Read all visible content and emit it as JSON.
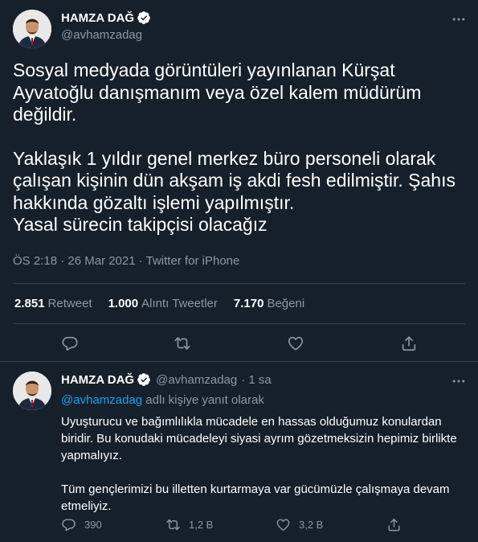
{
  "tweet": {
    "author_name": "HAMZA DAĞ",
    "author_handle": "@avhamzadag",
    "paragraphs": [
      "Sosyal medyada görüntüleri yayınlanan Kürşat Ayvatoğlu danışmanım veya özel kalem müdürüm değildir.",
      "Yaklaşık 1 yıldır genel merkez büro personeli olarak çalışan kişinin dün akşam iş akdi fesh edilmiştir. Şahıs hakkında gözaltı işlemi yapılmıştır.\nYasal sürecin takipçisi olacağız"
    ],
    "meta": "ÖS 2:18 · 26 Mar 2021 · Twitter for iPhone",
    "stats": {
      "retweets": "2.851",
      "retweets_label": "Retweet",
      "quotes": "1.000",
      "quotes_label": "Alıntı Tweetler",
      "likes": "7.170",
      "likes_label": "Beğeni"
    },
    "icons": [
      "reply-icon",
      "retweet-icon",
      "like-icon",
      "share-icon",
      "more-icon",
      "verified-icon"
    ]
  },
  "reply": {
    "author_name": "HAMZA DAĞ",
    "author_handle": "@avhamzadag",
    "time": "· 1 sa",
    "reply_to_mention": "@avhamzadag",
    "reply_to_suffix": "adlı kişiye yanıt olarak",
    "paragraphs": [
      "Uyuşturucu ve bağımlılıkla mücadele en hassas olduğumuz konulardan biridir. Bu konudaki mücadeleyi siyasi ayrım gözetmeksizin hepimiz birlikte yapmalıyız.",
      "Tüm gençlerimizi bu illetten kurtarmaya var gücümüzle çalışmaya devam etmeliyiz."
    ],
    "reply_count": "390",
    "retweet_count": "1,2 B",
    "like_count": "3,2 B"
  },
  "colors": {
    "background": "#15202b",
    "text": "#ffffff",
    "muted": "#8899a6",
    "accent": "#1da1f2",
    "divider": "#38444d"
  }
}
